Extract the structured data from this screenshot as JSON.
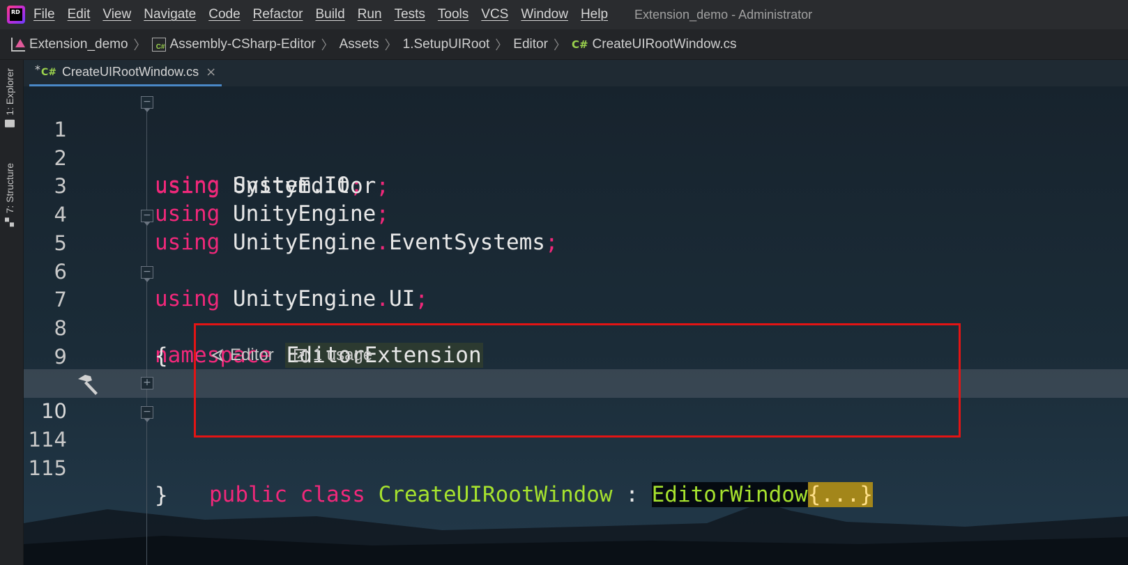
{
  "app": {
    "logo_text": "RD",
    "window_title": "Extension_demo - Administrator"
  },
  "menu": [
    "File",
    "Edit",
    "View",
    "Navigate",
    "Code",
    "Refactor",
    "Build",
    "Run",
    "Tests",
    "Tools",
    "VCS",
    "Window",
    "Help"
  ],
  "breadcrumb": [
    "Extension_demo",
    "Assembly-CSharp-Editor",
    "Assets",
    "1.SetupUIRoot",
    "Editor",
    "CreateUIRootWindow.cs"
  ],
  "breadcrumb_cs_badge": "C#",
  "toolstrip": {
    "explorer": "1: Explorer",
    "structure": "7: Structure"
  },
  "tab": {
    "modified_marker": "*",
    "cs_badge": "C#",
    "label": "CreateUIRootWindow.cs",
    "close": "×"
  },
  "editor": {
    "line_numbers": [
      "1",
      "2",
      "3",
      "4",
      "5",
      "6",
      "7",
      "8",
      "9",
      "10",
      "114",
      "115"
    ],
    "lines": {
      "l1": {
        "kw": "using",
        "name": "System.IO",
        "semi": ";"
      },
      "l2": {
        "kw": "using",
        "name": "UnityEditor",
        "semi": ";"
      },
      "l3": {
        "kw": "using",
        "name": "UnityEngine",
        "semi": ";"
      },
      "l4": {
        "kw": "using",
        "name_a": "UnityEngine",
        "dot": ".",
        "name_b": "EventSystems",
        "semi": ";"
      },
      "l5": {
        "kw": "using",
        "name_a": "UnityEngine",
        "dot": ".",
        "name_b": "UI",
        "semi": ";"
      },
      "l7": {
        "kw": "namespace",
        "name": "EditorExtension"
      },
      "l8": {
        "brace": "{"
      },
      "l10": {
        "kw1": "public",
        "kw2": "class",
        "cls": "CreateUIRootWindow",
        "colon": ":",
        "base": "EditorWindow",
        "fold": "{...}"
      },
      "l114": {
        "brace": "}"
      }
    },
    "codelens": {
      "editor_label": "Editor",
      "usage_label": "1 usage"
    },
    "fold_plus": "+",
    "fold_minus": "−"
  },
  "colors": {
    "keyword": "#f0287a",
    "class_name": "#a6e22e",
    "highlight_border": "#e31414",
    "tab_underline": "#4a88c7"
  },
  "icons": [
    "app-logo-icon",
    "unity-project-icon",
    "csharp-project-icon",
    "chevron-right-icon",
    "csharp-file-icon",
    "folder-icon",
    "structure-icon",
    "close-icon",
    "hammer-icon",
    "unity-editor-icon",
    "usage-link-icon"
  ]
}
